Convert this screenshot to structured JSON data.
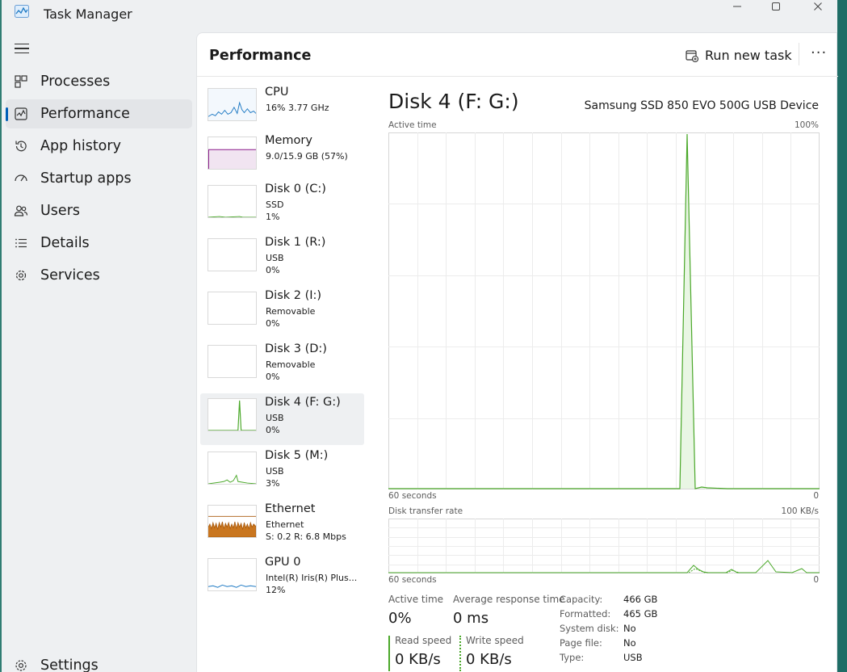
{
  "window": {
    "title": "Task Manager",
    "controls": [
      "minimize-icon",
      "maximize-icon",
      "close-icon"
    ]
  },
  "nav": {
    "menu_icon": "hamburger-icon",
    "items": [
      {
        "label": "Processes",
        "icon": "processes-icon",
        "active": false
      },
      {
        "label": "Performance",
        "icon": "performance-icon",
        "active": true
      },
      {
        "label": "App history",
        "icon": "history-icon",
        "active": false
      },
      {
        "label": "Startup apps",
        "icon": "startup-icon",
        "active": false
      },
      {
        "label": "Users",
        "icon": "users-icon",
        "active": false
      },
      {
        "label": "Details",
        "icon": "details-icon",
        "active": false
      },
      {
        "label": "Services",
        "icon": "services-icon",
        "active": false
      }
    ],
    "settings_label": "Settings"
  },
  "header": {
    "title": "Performance",
    "run_task_label": "Run new task",
    "more_label": "···"
  },
  "perf_list": [
    {
      "name": "CPU",
      "line2": "16%  3.77 GHz",
      "line3": "",
      "color": "#1f7ac4"
    },
    {
      "name": "Memory",
      "line2": "9.0/15.9 GB (57%)",
      "line3": "",
      "color": "#8b1a8b"
    },
    {
      "name": "Disk 0 (C:)",
      "line2": "SSD",
      "line3": "1%",
      "color": "#4aa829"
    },
    {
      "name": "Disk 1 (R:)",
      "line2": "USB",
      "line3": "0%",
      "color": "#4aa829"
    },
    {
      "name": "Disk 2 (I:)",
      "line2": "Removable",
      "line3": "0%",
      "color": "#4aa829"
    },
    {
      "name": "Disk 3 (D:)",
      "line2": "Removable",
      "line3": "0%",
      "color": "#4aa829"
    },
    {
      "name": "Disk 4 (F: G:)",
      "line2": "USB",
      "line3": "0%",
      "color": "#4aa829",
      "selected": true
    },
    {
      "name": "Disk 5 (M:)",
      "line2": "USB",
      "line3": "3%",
      "color": "#4aa829"
    },
    {
      "name": "Ethernet",
      "line2": "Ethernet",
      "line3": "S: 0.2  R: 6.8 Mbps",
      "color": "#a8590c"
    },
    {
      "name": "GPU 0",
      "line2": "Intel(R) Iris(R) Plus...",
      "line3": "12%",
      "color": "#1f7ac4"
    }
  ],
  "detail": {
    "title": "Disk 4 (F: G:)",
    "device": "Samsung SSD 850 EVO 500G USB Device",
    "active_graph": {
      "label": "Active time",
      "max_label": "100%",
      "x_label": "60 seconds",
      "min_label": "0",
      "color": "#4aa829"
    },
    "transfer_graph": {
      "label": "Disk transfer rate",
      "max_label": "100 KB/s",
      "x_label": "60 seconds",
      "min_label": "0",
      "color": "#4aa829"
    },
    "stats": {
      "active_time_label": "Active time",
      "active_time_value": "0%",
      "avg_response_label": "Average response time",
      "avg_response_value": "0 ms",
      "read_speed_label": "Read speed",
      "read_speed_value": "0 KB/s",
      "write_speed_label": "Write speed",
      "write_speed_value": "0 KB/s"
    },
    "properties": [
      {
        "key": "Capacity:",
        "value": "466 GB"
      },
      {
        "key": "Formatted:",
        "value": "465 GB"
      },
      {
        "key": "System disk:",
        "value": "No"
      },
      {
        "key": "Page file:",
        "value": "No"
      },
      {
        "key": "Type:",
        "value": "USB"
      }
    ]
  }
}
